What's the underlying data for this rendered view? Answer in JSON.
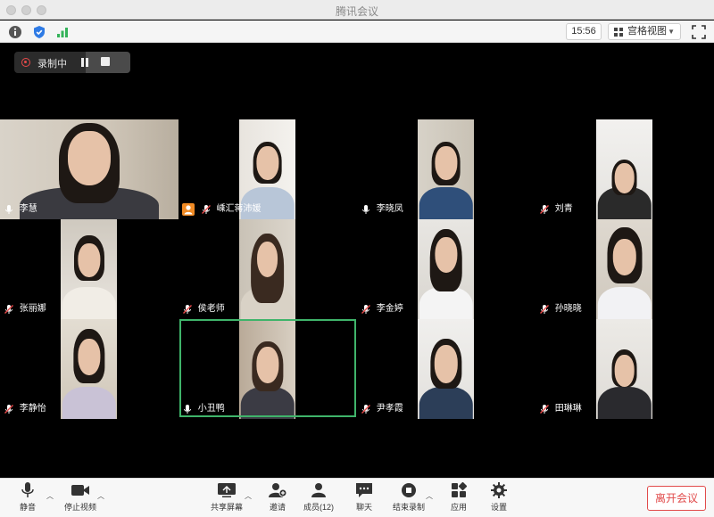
{
  "window": {
    "title": "腾讯会议"
  },
  "infobar": {
    "info_icon": "info-icon",
    "security_icon": "shield-icon",
    "signal_icon": "signal-icon",
    "time": "15:56",
    "view_label": "宫格视图",
    "fullscreen_icon": "fullscreen-icon"
  },
  "recording": {
    "label": "录制中"
  },
  "participants": [
    {
      "name": "李慧",
      "mic": "on"
    },
    {
      "name": "嵊汇蒋沛媛",
      "mic": "muted",
      "host": true
    },
    {
      "name": "李晓凤",
      "mic": "on"
    },
    {
      "name": "刘青",
      "mic": "muted"
    },
    {
      "name": "张丽娜",
      "mic": "muted"
    },
    {
      "name": "侯老师",
      "mic": "muted"
    },
    {
      "name": "李金婷",
      "mic": "muted"
    },
    {
      "name": "孙晓晓",
      "mic": "muted"
    },
    {
      "name": "李静怡",
      "mic": "muted"
    },
    {
      "name": "小丑鸭",
      "mic": "on",
      "active": true
    },
    {
      "name": "尹孝霞",
      "mic": "muted"
    },
    {
      "name": "田琳琳",
      "mic": "muted"
    }
  ],
  "toolbar": {
    "mute": "静音",
    "stop_video": "停止视频",
    "share_screen": "共享屏幕",
    "invite": "邀请",
    "members": "成员(12)",
    "chat": "聊天",
    "stop_recording": "结束录制",
    "apps": "应用",
    "settings": "设置",
    "leave": "离开会议"
  },
  "colors": {
    "active_speaker": "#3fb46a",
    "leave": "#e14b4b",
    "recording": "#e84a4a",
    "host_badge": "#f08a24"
  }
}
